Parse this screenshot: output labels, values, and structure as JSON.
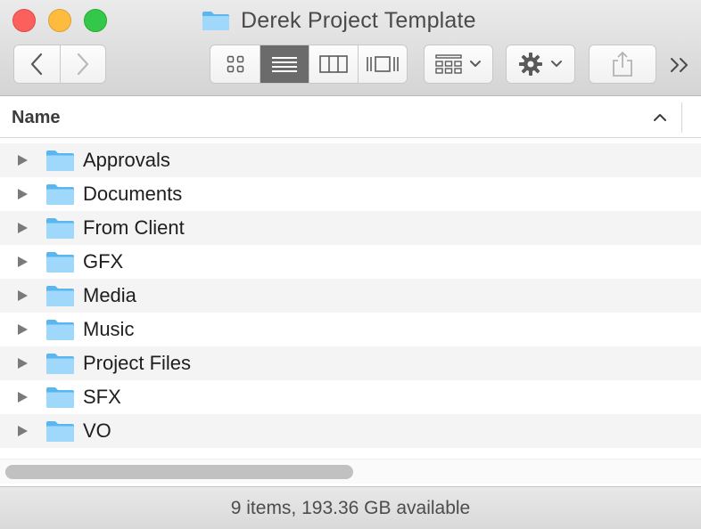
{
  "window": {
    "title": "Derek Project Template",
    "title_icon": "folder-icon"
  },
  "toolbar": {
    "back_icon": "chevron-left-icon",
    "forward_icon": "chevron-right-icon",
    "view_modes": [
      {
        "icon": "icon-view-icon",
        "active": false
      },
      {
        "icon": "list-view-icon",
        "active": true
      },
      {
        "icon": "column-view-icon",
        "active": false
      },
      {
        "icon": "cover-flow-icon",
        "active": false
      }
    ],
    "arrange_icon": "arrange-grid-icon",
    "action_icon": "gear-icon",
    "share_icon": "share-icon",
    "more_icon": "double-chevron-right-icon"
  },
  "columns": {
    "name_label": "Name",
    "sort_icon": "chevron-up-icon"
  },
  "items": [
    {
      "name": "Approvals"
    },
    {
      "name": "Documents"
    },
    {
      "name": "From Client"
    },
    {
      "name": "GFX"
    },
    {
      "name": "Media"
    },
    {
      "name": "Music"
    },
    {
      "name": "Project Files"
    },
    {
      "name": "SFX"
    },
    {
      "name": "VO"
    }
  ],
  "status": {
    "text": "9 items, 193.36 GB available"
  },
  "colors": {
    "folder_light": "#9fd8fb",
    "folder_dark": "#59b6ee",
    "active_view": "#6b6b6b"
  }
}
